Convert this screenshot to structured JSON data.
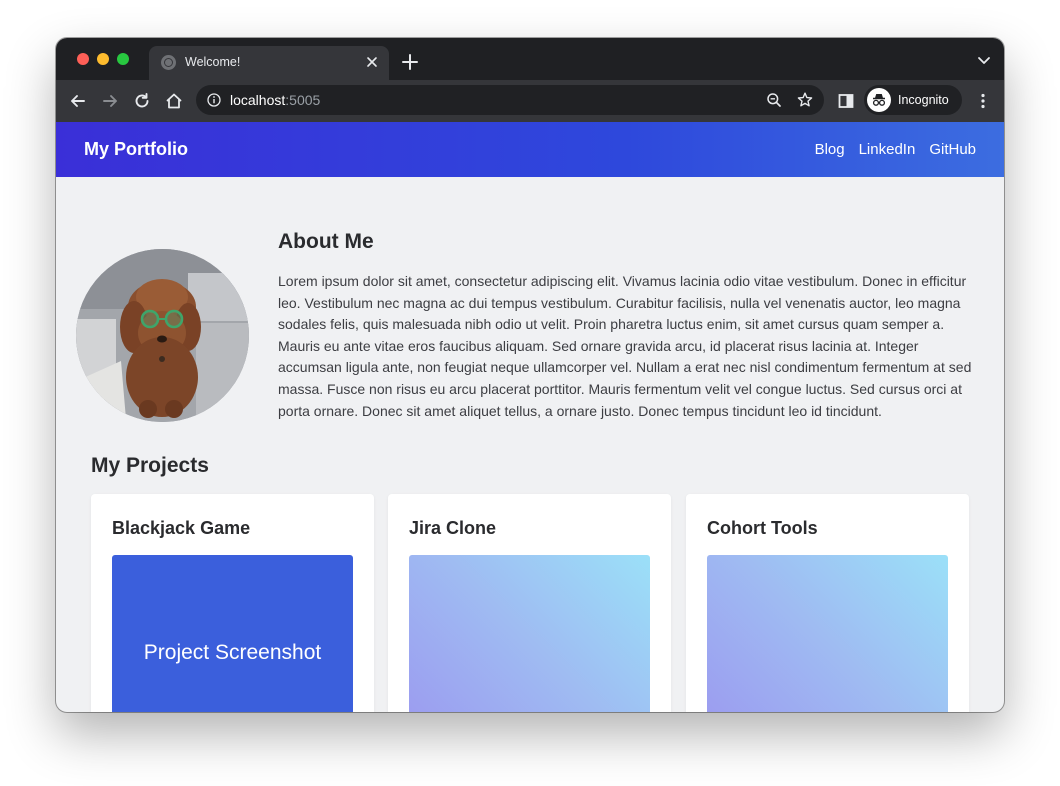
{
  "browser": {
    "tab_title": "Welcome!",
    "url_host": "localhost",
    "url_port": ":5005",
    "profile_label": "Incognito"
  },
  "site": {
    "brand": "My Portfolio",
    "nav": [
      "Blog",
      "LinkedIn",
      "GitHub"
    ]
  },
  "about": {
    "title": "About Me",
    "body": "Lorem ipsum dolor sit amet, consectetur adipiscing elit. Vivamus lacinia odio vitae vestibulum. Donec in efficitur leo. Vestibulum nec magna ac dui tempus vestibulum. Curabitur facilisis, nulla vel venenatis auctor, leo magna sodales felis, quis malesuada nibh odio ut velit. Proin pharetra luctus enim, sit amet cursus quam semper a. Mauris eu ante vitae eros faucibus aliquam. Sed ornare gravida arcu, id placerat risus lacinia at. Integer accumsan ligula ante, non feugiat neque ullamcorper vel. Nullam a erat nec nisl condimentum fermentum at sed massa. Fusce non risus eu arcu placerat porttitor. Mauris fermentum velit vel congue luctus. Sed cursus orci at porta ornare. Donec sit amet aliquet tellus, a ornare justo. Donec tempus tincidunt leo id tincidunt."
  },
  "projects": {
    "title": "My Projects",
    "items": [
      {
        "name": "Blackjack Game",
        "screenshot_label": "Project Screenshot"
      },
      {
        "name": "Jira Clone",
        "screenshot_label": ""
      },
      {
        "name": "Cohort Tools",
        "screenshot_label": ""
      }
    ]
  },
  "colors": {
    "header_gradient_start": "#3a2fd8",
    "header_gradient_end": "#3c6de0",
    "screenshot_solid": "#3b5fdc"
  },
  "icons": {
    "traffic_lights": [
      "close",
      "minimize",
      "zoom"
    ],
    "toolbar": [
      "back-arrow-icon",
      "forward-arrow-icon",
      "reload-icon",
      "home-icon",
      "info-icon",
      "zoom-icon",
      "star-icon",
      "side-panel-icon",
      "incognito-icon",
      "kebab-menu-icon"
    ]
  }
}
